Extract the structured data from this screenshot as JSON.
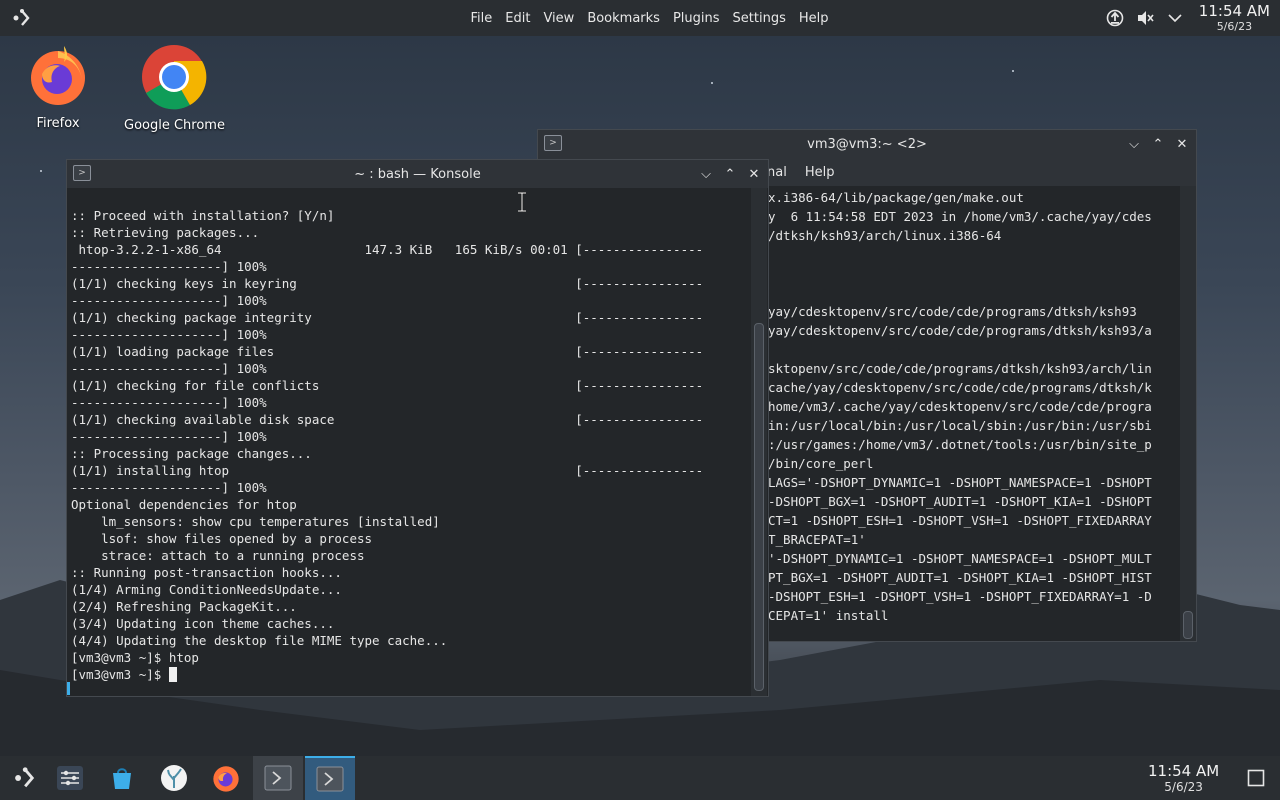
{
  "top_menu": [
    "File",
    "Edit",
    "View",
    "Bookmarks",
    "Plugins",
    "Settings",
    "Help"
  ],
  "clock": {
    "time": "11:54 AM",
    "date": "5/6/23"
  },
  "desktop_icons": [
    {
      "label": "Firefox"
    },
    {
      "label": "Google Chrome"
    }
  ],
  "back_window": {
    "title": "vm3@vm3:~ <2>",
    "menu_partial": "nal",
    "menu_help": "Help",
    "lines": [
      "x.i386-64/lib/package/gen/make.out",
      "y  6 11:54:58 EDT 2023 in /home/vm3/.cache/yay/cdes",
      "/dtksh/ksh93/arch/linux.i386-64",
      "",
      "",
      "",
      "yay/cdesktopenv/src/code/cde/programs/dtksh/ksh93",
      "yay/cdesktopenv/src/code/cde/programs/dtksh/ksh93/a",
      "",
      "sktopenv/src/code/cde/programs/dtksh/ksh93/arch/lin",
      "cache/yay/cdesktopenv/src/code/cde/programs/dtksh/k",
      "home/vm3/.cache/yay/cdesktopenv/src/code/cde/progra",
      "in:/usr/local/bin:/usr/local/sbin:/usr/bin:/usr/sbi",
      ":/usr/games:/home/vm3/.dotnet/tools:/usr/bin/site_p",
      "/bin/core_perl",
      "LAGS='-DSHOPT_DYNAMIC=1 -DSHOPT_NAMESPACE=1 -DSHOPT",
      "-DSHOPT_BGX=1 -DSHOPT_AUDIT=1 -DSHOPT_KIA=1 -DSHOPT",
      "CT=1 -DSHOPT_ESH=1 -DSHOPT_VSH=1 -DSHOPT_FIXEDARRAY",
      "T_BRACEPAT=1'",
      "'-DSHOPT_DYNAMIC=1 -DSHOPT_NAMESPACE=1 -DSHOPT_MULT",
      "PT_BGX=1 -DSHOPT_AUDIT=1 -DSHOPT_KIA=1 -DSHOPT_HIST",
      "-DSHOPT_ESH=1 -DSHOPT_VSH=1 -DSHOPT_FIXEDARRAY=1 -D",
      "CEPAT=1' install"
    ]
  },
  "front_window": {
    "title": "~ : bash — Konsole",
    "lines": [
      ":: Proceed with installation? [Y/n]",
      ":: Retrieving packages...",
      " htop-3.2.2-1-x86_64                   147.3 KiB   165 KiB/s 00:01 [----------------",
      "--------------------] 100%",
      "(1/1) checking keys in keyring                                     [----------------",
      "--------------------] 100%",
      "(1/1) checking package integrity                                   [----------------",
      "--------------------] 100%",
      "(1/1) loading package files                                        [----------------",
      "--------------------] 100%",
      "(1/1) checking for file conflicts                                  [----------------",
      "--------------------] 100%",
      "(1/1) checking available disk space                                [----------------",
      "--------------------] 100%",
      ":: Processing package changes...",
      "(1/1) installing htop                                              [----------------",
      "--------------------] 100%",
      "Optional dependencies for htop",
      "    lm_sensors: show cpu temperatures [installed]",
      "    lsof: show files opened by a process",
      "    strace: attach to a running process",
      ":: Running post-transaction hooks...",
      "(1/4) Arming ConditionNeedsUpdate...",
      "(2/4) Refreshing PackageKit...",
      "(3/4) Updating icon theme caches...",
      "(4/4) Updating the desktop file MIME type cache...",
      "[vm3@vm3 ~]$ htop"
    ],
    "prompt": "[vm3@vm3 ~]$ "
  },
  "colors": {
    "accent": "#3daee9",
    "panel": "#2a2e32",
    "terminal_bg": "#232629"
  }
}
